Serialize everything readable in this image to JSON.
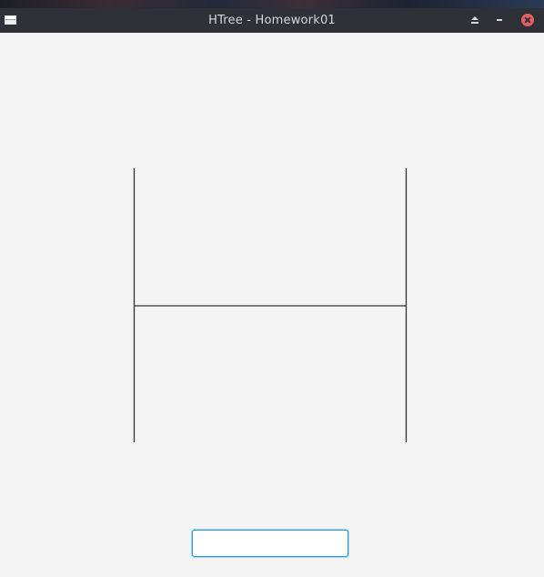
{
  "window": {
    "title": "HTree - Homework01"
  },
  "titlebar_buttons": [
    {
      "name": "shade",
      "icon": "eject-icon"
    },
    {
      "name": "minimize",
      "icon": "minimize-icon"
    },
    {
      "name": "close",
      "icon": "close-icon",
      "color": "#e35f62"
    }
  ],
  "input": {
    "value": "",
    "placeholder": ""
  },
  "colors": {
    "titlebar": "#2f3138",
    "background": "#f4f4f4",
    "line": "#333333",
    "focus_border": "#2a9bd6"
  }
}
